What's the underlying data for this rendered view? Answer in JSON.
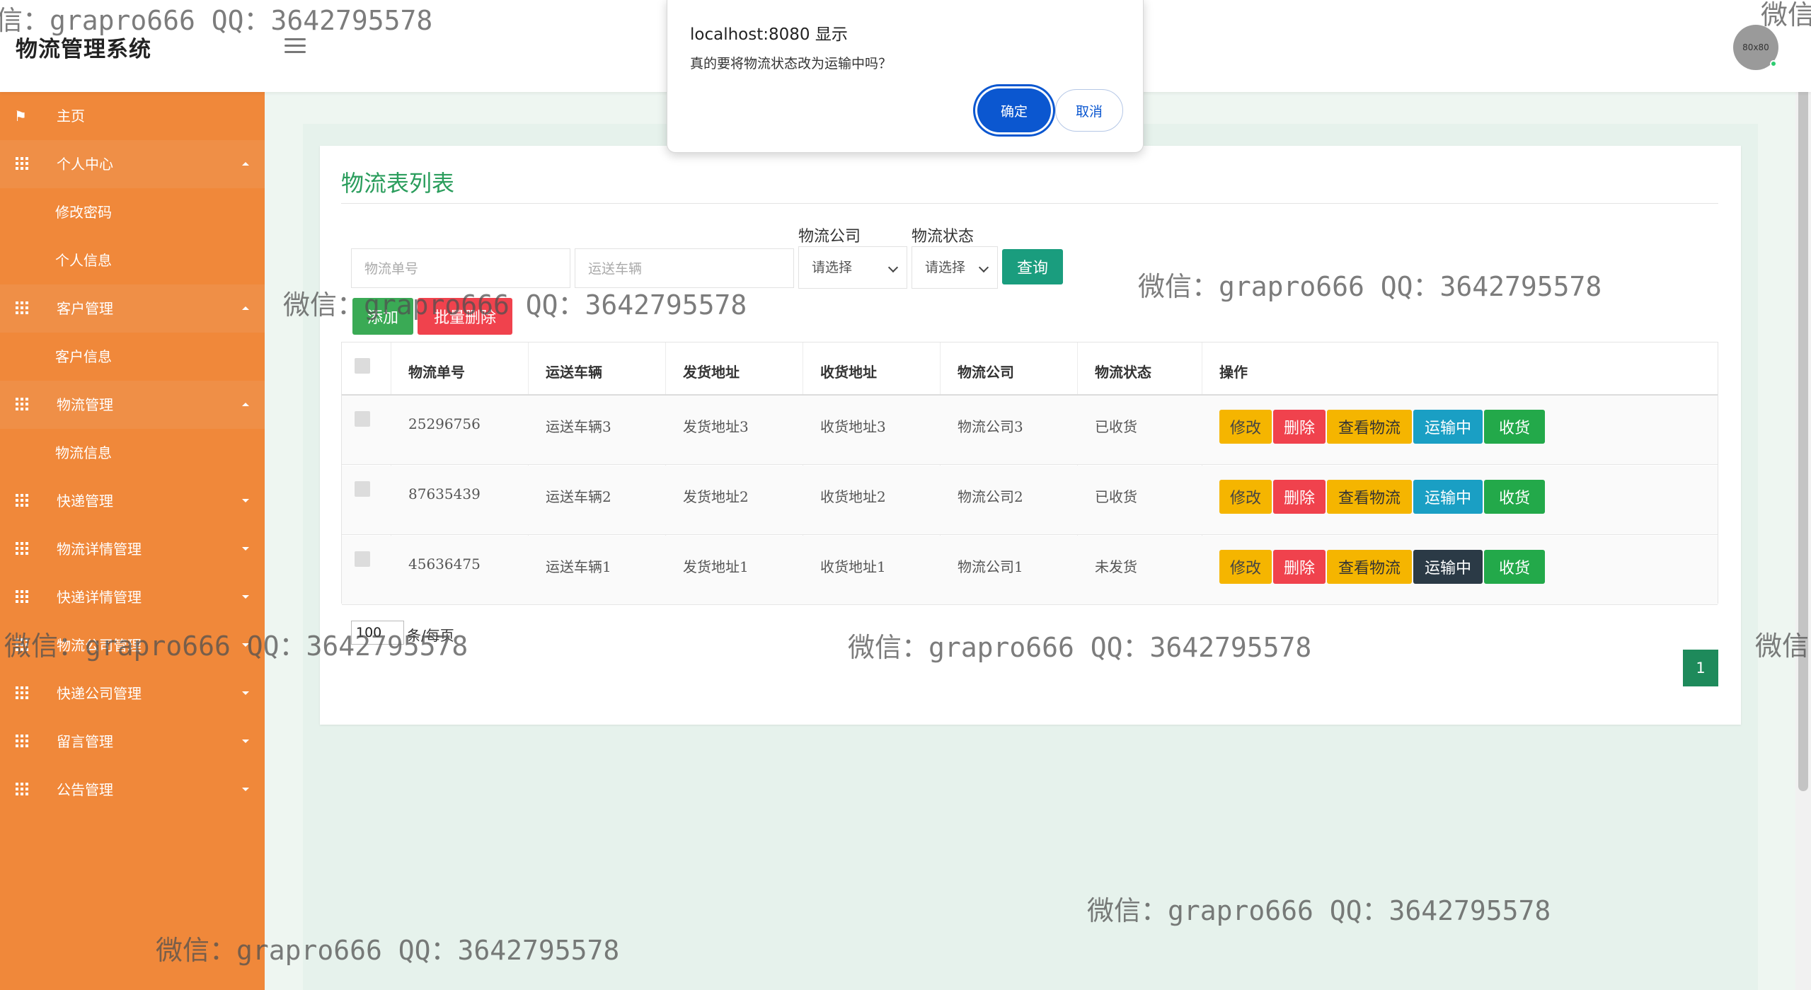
{
  "header": {
    "brand": "物流管理系统",
    "avatar_text": "80x80"
  },
  "sidebar": {
    "items": [
      {
        "label": "主页",
        "type": "top",
        "icon": "flag-icon"
      },
      {
        "label": "个人中心",
        "type": "group",
        "caret": "up"
      },
      {
        "label": "修改密码",
        "type": "sub"
      },
      {
        "label": "个人信息",
        "type": "sub"
      },
      {
        "label": "客户管理",
        "type": "group",
        "caret": "up"
      },
      {
        "label": "客户信息",
        "type": "sub"
      },
      {
        "label": "物流管理",
        "type": "group",
        "caret": "up"
      },
      {
        "label": "物流信息",
        "type": "sub"
      },
      {
        "label": "快递管理",
        "type": "group",
        "caret": "down"
      },
      {
        "label": "物流详情管理",
        "type": "group",
        "caret": "down"
      },
      {
        "label": "快递详情管理",
        "type": "group",
        "caret": "down"
      },
      {
        "label": "物流公司管理",
        "type": "group",
        "caret": "down"
      },
      {
        "label": "快递公司管理",
        "type": "group",
        "caret": "down"
      },
      {
        "label": "留言管理",
        "type": "group",
        "caret": "down"
      },
      {
        "label": "公告管理",
        "type": "group",
        "caret": "down"
      }
    ]
  },
  "page": {
    "title": "物流表列表"
  },
  "filters": {
    "order_no_placeholder": "物流单号",
    "vehicle_placeholder": "运送车辆",
    "company_label": "物流公司",
    "company_value": "请选择",
    "status_label": "物流状态",
    "status_value": "请选择",
    "query_label": "查询"
  },
  "toolbar": {
    "add_label": "添加",
    "bulk_delete_label": "批量删除"
  },
  "table": {
    "headers": [
      "物流单号",
      "运送车辆",
      "发货地址",
      "收货地址",
      "物流公司",
      "物流状态",
      "操作"
    ],
    "rows": [
      {
        "order_no": "25296756",
        "vehicle": "运送车辆3",
        "from": "发货地址3",
        "to": "收货地址3",
        "company": "物流公司3",
        "status": "已收货"
      },
      {
        "order_no": "87635439",
        "vehicle": "运送车辆2",
        "from": "发货地址2",
        "to": "收货地址2",
        "company": "物流公司2",
        "status": "已收货"
      },
      {
        "order_no": "45636475",
        "vehicle": "运送车辆1",
        "from": "发货地址1",
        "to": "收货地址1",
        "company": "物流公司1",
        "status": "未发货"
      }
    ],
    "actions": {
      "edit": "修改",
      "delete": "删除",
      "view": "查看物流",
      "ship": "运输中",
      "receive": "收货"
    }
  },
  "pagination": {
    "page_size": "100",
    "page_size_suffix": "条/每页",
    "current_page": "1"
  },
  "dialog": {
    "title": "localhost:8080 显示",
    "message": "真的要将物流状态改为运输中吗？",
    "ok_label": "确定",
    "cancel_label": "取消"
  },
  "watermark": {
    "text": "微信：grapro666 QQ：3642795578",
    "edge_left": "信：grapro666 QQ：3642795578",
    "edge_right": "微信"
  },
  "colors": {
    "sidebar": "#f0883a",
    "title_green": "#2a9d5c",
    "primary_blue": "#0b57d0"
  }
}
